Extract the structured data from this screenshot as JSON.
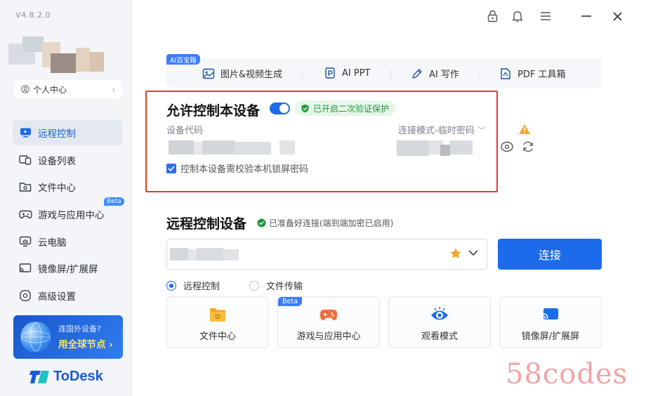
{
  "app": {
    "version": "V4.8.2.0",
    "logo_text": "ToDesk"
  },
  "sidebar": {
    "personal_center": "个人中心",
    "items": [
      {
        "label": "远程控制",
        "icon": "monitor-icon",
        "active": true
      },
      {
        "label": "设备列表",
        "icon": "device-list-icon"
      },
      {
        "label": "文件中心",
        "icon": "folder-icon"
      },
      {
        "label": "游戏与应用中心",
        "icon": "gamepad-icon",
        "badge": "Beta"
      },
      {
        "label": "云电脑",
        "icon": "cloud-pc-icon"
      },
      {
        "label": "镜像屏/扩展屏",
        "icon": "cast-icon"
      },
      {
        "label": "高级设置",
        "icon": "gear-icon"
      }
    ],
    "promo": {
      "line1": "连国外设备?",
      "line2": "用全球节点 ›"
    }
  },
  "ai_toolbox": {
    "tag": "AI百宝箱",
    "items": [
      {
        "label": "图片&视频生成",
        "icon": "image-video-icon"
      },
      {
        "label": "AI PPT",
        "icon": "ppt-icon"
      },
      {
        "label": "AI 写作",
        "icon": "pen-icon"
      },
      {
        "label": "PDF 工具箱",
        "icon": "pdf-icon"
      }
    ]
  },
  "allow_control": {
    "title": "允许控制本设备",
    "security_badge": "已开启二次验证保护",
    "device_code_label": "设备代码",
    "connect_mode": "连接模式-临时密码",
    "lock_screen_check": "控制本设备需校验本机锁屏密码"
  },
  "remote_control": {
    "title": "远程控制设备",
    "ready_status": "已准备好连接(端到端加密已启用)",
    "connect_button": "连接",
    "modes": [
      {
        "label": "远程控制",
        "selected": true
      },
      {
        "label": "文件传输",
        "selected": false
      }
    ],
    "cards": [
      {
        "label": "文件中心",
        "icon": "folder-icon"
      },
      {
        "label": "游戏与应用中心",
        "icon": "gamepad-icon",
        "badge": "Beta"
      },
      {
        "label": "观看模式",
        "icon": "eye-icon"
      },
      {
        "label": "镜像屏/扩展屏",
        "icon": "cast-icon"
      }
    ]
  },
  "watermark": "58codes",
  "colors": {
    "accent": "#1b6bea",
    "highlight_border": "#e03b2f",
    "secure_green": "#22953d",
    "warning": "#f5a623"
  }
}
